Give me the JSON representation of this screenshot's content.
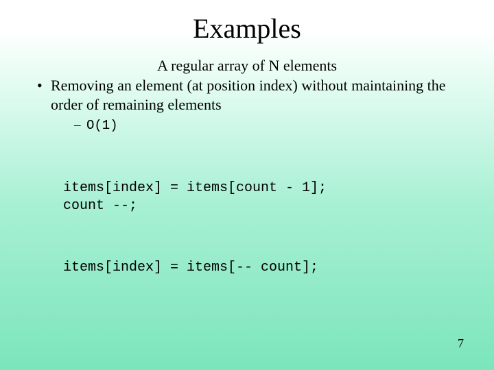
{
  "title": "Examples",
  "subtitle": "A regular array of N elements",
  "bullet": "Removing an element (at position index) without maintaining the order of remaining elements",
  "sub_bullet": "O(1)",
  "code1_line1": "items[index] = items[count - 1];",
  "code1_line2": "count --;",
  "code2_line1": "items[index] = items[-- count];",
  "page_number": "7"
}
